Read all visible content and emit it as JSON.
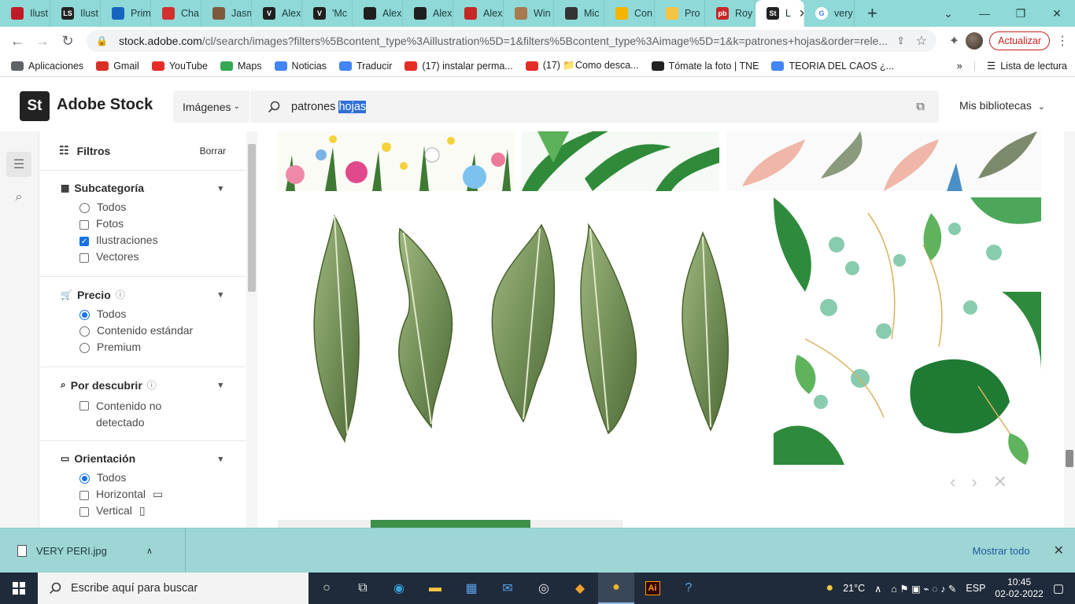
{
  "browser": {
    "tabs": [
      {
        "label": "Ilust",
        "fav_color": "#c01c28",
        "fav_text": ""
      },
      {
        "label": "Ilust",
        "fav_color": "#222222",
        "fav_text": "LS"
      },
      {
        "label": "Prim",
        "fav_color": "#1565c0",
        "fav_text": ""
      },
      {
        "label": "Cha",
        "fav_color": "#d32f2f",
        "fav_text": ""
      },
      {
        "label": "Jasm",
        "fav_color": "#7e5a3c",
        "fav_text": ""
      },
      {
        "label": "Alex",
        "fav_color": "#1f1f1f",
        "fav_text": "V"
      },
      {
        "label": "'Mc",
        "fav_color": "#1f1f1f",
        "fav_text": "V"
      },
      {
        "label": "Alex",
        "fav_color": "#1f1f1f",
        "fav_text": ""
      },
      {
        "label": "Alex",
        "fav_color": "#1f1f1f",
        "fav_text": ""
      },
      {
        "label": "Alex",
        "fav_color": "#c62828",
        "fav_text": ""
      },
      {
        "label": "Win",
        "fav_color": "#a77b4f",
        "fav_text": ""
      },
      {
        "label": "Mic",
        "fav_color": "#333333",
        "fav_text": ""
      },
      {
        "label": "Con",
        "fav_color": "#f4b400",
        "fav_text": ""
      },
      {
        "label": "Pro",
        "fav_color": "#f6c342",
        "fav_text": ""
      },
      {
        "label": "Roy",
        "fav_color": "#c62828",
        "fav_text": "pb"
      }
    ],
    "active_tab": {
      "label": "L",
      "fav_text": "St"
    },
    "after_tab": {
      "label": "very"
    },
    "url_host": "stock.adobe.com",
    "url_path": "/cl/search/images?filters%5Bcontent_type%3Aillustration%5D=1&filters%5Bcontent_type%3Aimage%5D=1&k=patrones+hojas&order=rele...",
    "update_label": "Actualizar",
    "bookmarks": [
      {
        "label": "Aplicaciones",
        "color": "#5f6368"
      },
      {
        "label": "Gmail",
        "color": "#d93025"
      },
      {
        "label": "YouTube",
        "color": "#e52d27"
      },
      {
        "label": "Maps",
        "color": "#34a853"
      },
      {
        "label": "Noticias",
        "color": "#4285f4"
      },
      {
        "label": "Traducir",
        "color": "#4285f4"
      },
      {
        "label": "(17) instalar perma...",
        "color": "#e52d27"
      },
      {
        "label": "(17) 📁Como desca...",
        "color": "#e52d27"
      },
      {
        "label": "Tómate la foto | TNE",
        "color": "#222222"
      },
      {
        "label": "TEORIA DEL CAOS ¿...",
        "color": "#4285f4"
      }
    ],
    "reading_list_label": "Lista de lectura"
  },
  "stock": {
    "logo_abbr": "St",
    "logo_name": "Adobe Stock",
    "search_type": "Imágenes",
    "query_plain": "patrones",
    "query_selected": "hojas",
    "libraries_label": "Mis bibliotecas"
  },
  "filters": {
    "title": "Filtros",
    "clear": "Borrar",
    "sections": {
      "subcategory": {
        "title": "Subcategoría",
        "options": [
          "Todos",
          "Fotos",
          "Ilustraciones",
          "Vectores"
        ]
      },
      "price": {
        "title": "Precio",
        "options": [
          "Todos",
          "Contenido estándar",
          "Premium"
        ]
      },
      "discover": {
        "title": "Por descubrir",
        "options": [
          "Contenido no detectado"
        ]
      },
      "orientation": {
        "title": "Orientación",
        "options": [
          "Todos",
          "Horizontal",
          "Vertical"
        ]
      }
    }
  },
  "downloads": {
    "file": "VERY PERI.jpg",
    "show_all": "Mostrar todo"
  },
  "taskbar": {
    "search_placeholder": "Escribe aquí para buscar",
    "weather": "21°C",
    "lang": "ESP",
    "time": "10:45",
    "date": "02-02-2022"
  }
}
